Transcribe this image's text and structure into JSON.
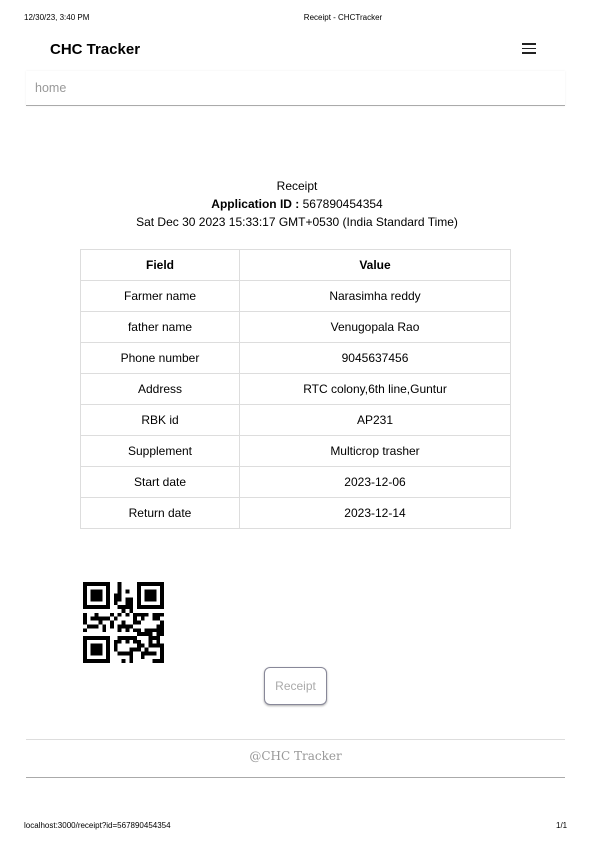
{
  "print_header": {
    "datetime": "12/30/23, 3:40 PM",
    "title": "Receipt - CHCTracker"
  },
  "navbar": {
    "brand": "CHC Tracker",
    "menu_icon": "hamburger-icon",
    "home": "home"
  },
  "receipt": {
    "heading": "Receipt",
    "app_id_label": "Application ID :",
    "app_id": "567890454354",
    "date": "Sat Dec 30 2023 15:33:17 GMT+0530 (India Standard Time)"
  },
  "table": {
    "headers": [
      "Field",
      "Value"
    ],
    "rows": [
      [
        "Farmer name",
        "Narasimha reddy"
      ],
      [
        "father name",
        "Venugopala Rao"
      ],
      [
        "Phone number",
        "9045637456"
      ],
      [
        "Address",
        "RTC colony,6th line,Guntur"
      ],
      [
        "RBK id",
        "AP231"
      ],
      [
        "Supplement",
        "Multicrop trasher"
      ],
      [
        "Start date",
        "2023-12-06"
      ],
      [
        "Return date",
        "2023-12-14"
      ]
    ]
  },
  "button": {
    "label": "Receipt"
  },
  "footer": {
    "text": "@CHC Tracker"
  },
  "print_footer": {
    "url": "localhost:3000/receipt?id=567890454354",
    "page": "1/1"
  }
}
